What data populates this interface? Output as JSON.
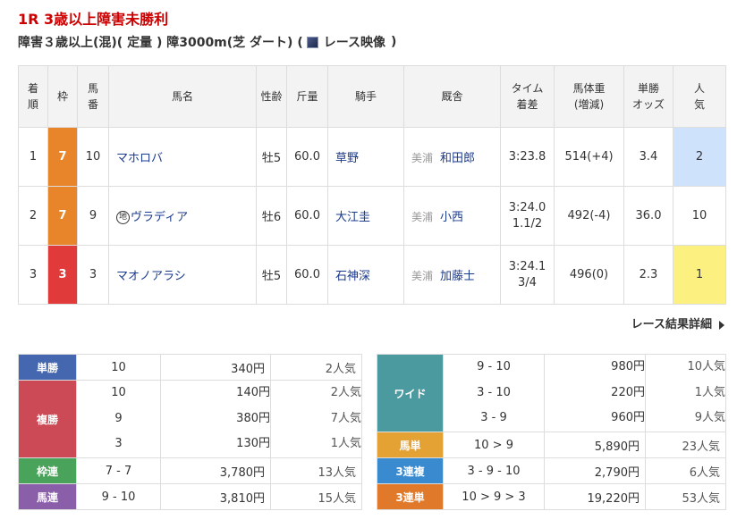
{
  "race": {
    "title": "1R 3歳以上障害未勝利",
    "condition": "障害３歳以上(混)( 定量 ) 障3000m(芝 ダート) (",
    "video_label": "レース映像",
    "close_paren": ")"
  },
  "results": {
    "headers": {
      "rank": [
        "着",
        "順"
      ],
      "waku": "枠",
      "umaban": [
        "馬",
        "番"
      ],
      "horse": "馬名",
      "sexage": "性齢",
      "weight": "斤量",
      "jockey": "騎手",
      "trainer": "厩舎",
      "time": [
        "タイム",
        "着差"
      ],
      "body": [
        "馬体重",
        "(増減)"
      ],
      "odds": [
        "単勝",
        "オッズ"
      ],
      "pop": [
        "人",
        "気"
      ]
    },
    "rows": [
      {
        "rank": "1",
        "waku": "7",
        "umaban": "10",
        "horse": "マホロバ",
        "chi": "",
        "sexage": "牡5",
        "weight": "60.0",
        "jockey": "草野",
        "region": "美浦",
        "trainer": "和田郎",
        "time": "3:23.8",
        "margin": "",
        "body": "514(+4)",
        "odds": "3.4",
        "pop": "2"
      },
      {
        "rank": "2",
        "waku": "7",
        "umaban": "9",
        "horse": "ヴラディア",
        "chi": "地",
        "sexage": "牡6",
        "weight": "60.0",
        "jockey": "大江圭",
        "region": "美浦",
        "trainer": "小西",
        "time": "3:24.0",
        "margin": "1.1/2",
        "body": "492(-4)",
        "odds": "36.0",
        "pop": "10"
      },
      {
        "rank": "3",
        "waku": "3",
        "umaban": "3",
        "horse": "マオノアラシ",
        "chi": "",
        "sexage": "牡5",
        "weight": "60.0",
        "jockey": "石神深",
        "region": "美浦",
        "trainer": "加藤士",
        "time": "3:24.1",
        "margin": "3/4",
        "body": "496(0)",
        "odds": "2.3",
        "pop": "1"
      }
    ]
  },
  "detail_link": "レース結果詳細",
  "payouts_left": {
    "tansho": {
      "label": "単勝",
      "comb": "10",
      "money": "340円",
      "ninki": "2人気"
    },
    "fukusho": {
      "label": "複勝",
      "combs": [
        "10",
        "9",
        "3"
      ],
      "moneys": [
        "140円",
        "380円",
        "130円"
      ],
      "ninkis": [
        "2人気",
        "7人気",
        "1人気"
      ]
    },
    "wakuren": {
      "label": "枠連",
      "comb": "7 - 7",
      "money": "3,780円",
      "ninki": "13人気"
    },
    "umaren": {
      "label": "馬連",
      "comb": "9 - 10",
      "money": "3,810円",
      "ninki": "15人気"
    }
  },
  "payouts_right": {
    "wide": {
      "label": "ワイド",
      "combs": [
        "9 - 10",
        "3 - 10",
        "3 - 9"
      ],
      "moneys": [
        "980円",
        "220円",
        "960円"
      ],
      "ninkis": [
        "10人気",
        "1人気",
        "9人気"
      ]
    },
    "umatan": {
      "label": "馬単",
      "comb": "10 > 9",
      "money": "5,890円",
      "ninki": "23人気"
    },
    "sanfuku": {
      "label": "3連複",
      "comb": "3 - 9 - 10",
      "money": "2,790円",
      "ninki": "6人気"
    },
    "santan": {
      "label": "3連単",
      "comb": "10 > 9 > 3",
      "money": "19,220円",
      "ninki": "53人気"
    }
  }
}
